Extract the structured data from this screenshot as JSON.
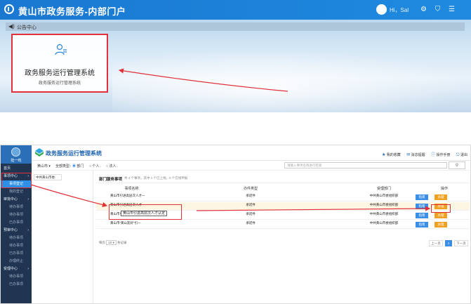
{
  "portal": {
    "title": "黄山市政务服务-内部门户",
    "user_name": "Hi，Sal",
    "notice_label": "公告中心",
    "card": {
      "title": "政务服务运行管理系统",
      "subtitle": "政务服务运行管理系统"
    }
  },
  "mgmt": {
    "system_title": "政务服务运行管理系统",
    "header_links": [
      "我的收藏",
      "消息提醒",
      "操作手册",
      "退出"
    ],
    "sidebar": {
      "user_name": "陆一鸣",
      "items": [
        {
          "label": "首页",
          "level": "head"
        },
        {
          "label": "事项中心",
          "level": "head"
        },
        {
          "label": "事项登记",
          "level": "sub",
          "active": true
        },
        {
          "label": "我的登记",
          "level": "sub"
        },
        {
          "label": "审批中心",
          "level": "head"
        },
        {
          "label": "待办事项",
          "level": "sub"
        },
        {
          "label": "待办事项",
          "level": "sub"
        },
        {
          "label": "已办事项",
          "level": "sub"
        },
        {
          "label": "预审中心",
          "level": "head"
        },
        {
          "label": "待办事项",
          "level": "sub"
        },
        {
          "label": "待办事项",
          "level": "sub"
        },
        {
          "label": "已办事项",
          "level": "sub"
        },
        {
          "label": "办理终止",
          "level": "sub"
        },
        {
          "label": "受理中心",
          "level": "head"
        },
        {
          "label": "待办事项",
          "level": "sub"
        },
        {
          "label": "已办事项",
          "level": "sub"
        }
      ]
    },
    "filters": {
      "region": "黄山市",
      "type_label": "全部类型",
      "opt1": "部门",
      "opt2": "个人",
      "opt3": "法人",
      "search_placeholder": "请输入事项名称进行检索"
    },
    "left_panel_item": "中共黄山市委·",
    "list": {
      "title": "部门服务事项",
      "stat": "共 4 个事项，其中 1 个已上线，0 个在线申报"
    },
    "table": {
      "headers": [
        "事项名称",
        "办件类型",
        "受理部门",
        "操作"
      ],
      "rows": [
        {
          "name": "黄山市引进高层次人才一",
          "type": "承诺件",
          "dept": "中共黄山市委组织部"
        },
        {
          "name": "黄山市引进高层次人才一",
          "type": "承诺件",
          "dept": "中共黄山市委组织部"
        },
        {
          "name": "黄山市引进高层次人才一",
          "type": "承诺件",
          "dept": "中共黄山市委组织部"
        },
        {
          "name": "黄山市“黄山友好”引一",
          "type": "承诺件",
          "dept": "中共黄山市委组织部"
        }
      ],
      "btn_guide": "指南",
      "btn_handle": "办理"
    },
    "tooltip": "黄山市引进高层次人才认定",
    "pager": {
      "per_page_prefix": "每页",
      "per_page_value": "10",
      "per_page_suffix": "条记录",
      "prev": "上一页",
      "current": "1",
      "next": "下一页"
    },
    "colors": {
      "sidebar": "#1f3552",
      "primary": "#3a8ee6",
      "warn": "#f0a020",
      "highlight": "#e0313a"
    }
  }
}
